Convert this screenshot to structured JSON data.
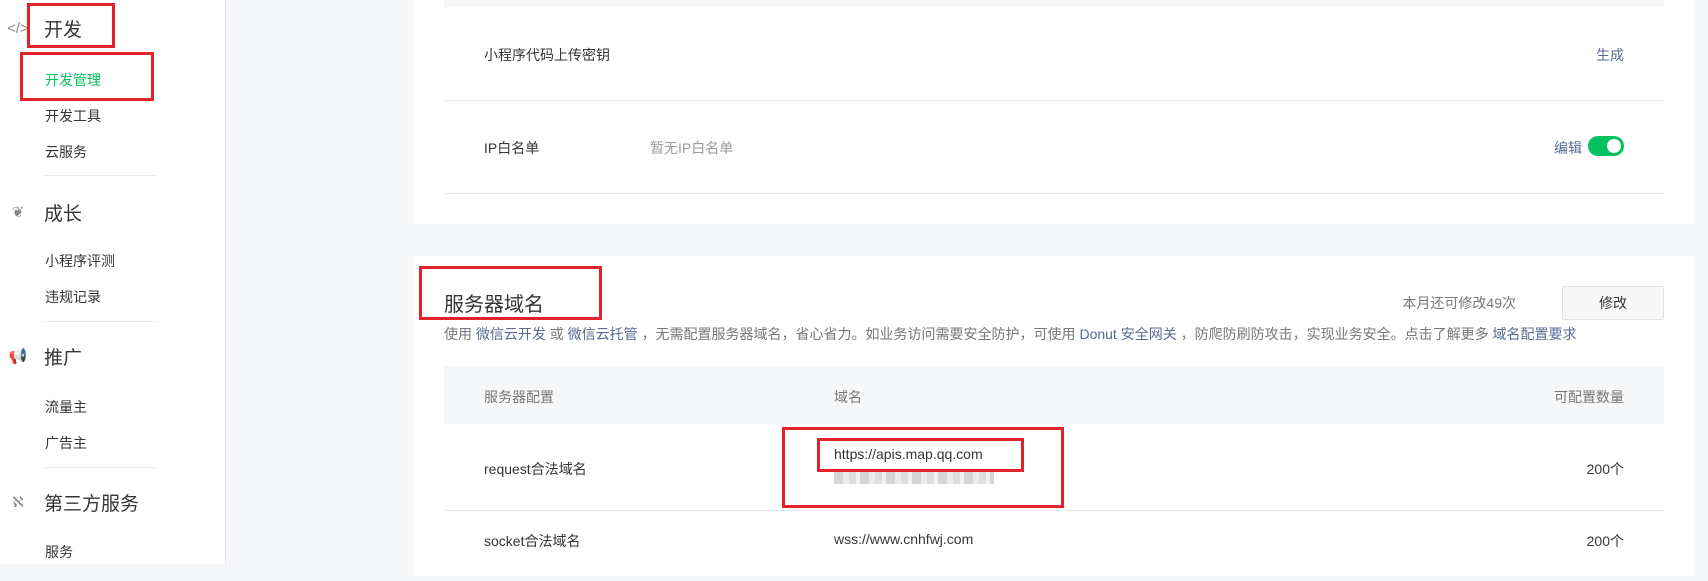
{
  "sidebar": {
    "groups": [
      {
        "icon": "code-icon",
        "icon_glyph": "</>",
        "title": "开发",
        "items": [
          "开发管理",
          "开发工具",
          "云服务"
        ]
      },
      {
        "icon": "sprout-icon",
        "icon_glyph": "❦",
        "title": "成长",
        "items": [
          "小程序评测",
          "违规记录"
        ]
      },
      {
        "icon": "megaphone-icon",
        "icon_glyph": "📢",
        "title": "推广",
        "items": [
          "流量主",
          "广告主"
        ]
      },
      {
        "icon": "third-party-icon",
        "icon_glyph": "ℵ",
        "title": "第三方服务",
        "items": [
          "服务"
        ]
      }
    ],
    "active_item": "开发管理"
  },
  "dev_settings": {
    "upload_key": {
      "label": "小程序代码上传密钥",
      "action": "生成"
    },
    "ip_whitelist": {
      "label": "IP白名单",
      "value": "暂无IP白名单",
      "action": "编辑",
      "toggle_on": true
    }
  },
  "server_domain": {
    "title": "服务器域名",
    "remaining": "本月还可修改49次",
    "modify_button": "修改",
    "notice": {
      "t1": "使用",
      "l1": "微信云开发",
      "t2": "或",
      "l2": "微信云托管",
      "t3": "，无需配置服务器域名，省心省力。如业务访问需要安全防护，可使用",
      "l3": "Donut 安全网关",
      "t4": "，防爬防刷防攻击，实现业务安全。点击了解更多",
      "l4": "域名配置要求"
    },
    "table": {
      "headers": [
        "服务器配置",
        "域名",
        "可配置数量"
      ],
      "rows": [
        {
          "type": "request合法域名",
          "domain": "https://apis.map.qq.com",
          "count": "200个"
        },
        {
          "type": "socket合法域名",
          "domain": "wss://www.cnhfwj.com",
          "count": "200个"
        }
      ]
    }
  },
  "colors": {
    "accent": "#07c160",
    "link": "#576b95",
    "highlight": "#e2232b"
  }
}
